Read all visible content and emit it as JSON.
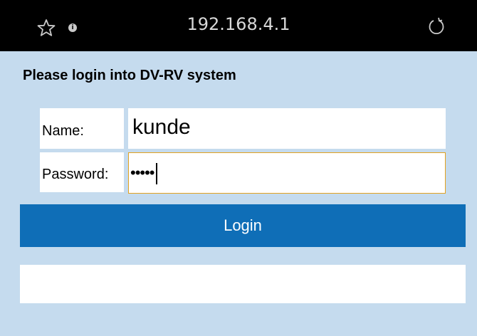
{
  "browser": {
    "url": "192.168.4.1",
    "icons": [
      "star-icon",
      "info-icon",
      "reload-icon"
    ],
    "info_glyph": "i"
  },
  "login": {
    "heading": "Please login into DV-RV system",
    "name_label": "Name:",
    "name_value": "kunde",
    "password_label": "Password:",
    "password_masked": "•••••",
    "button_label": "Login",
    "message": ""
  },
  "colors": {
    "page_background": "#c5dbee",
    "topbar": "#000000",
    "button": "#0f6eb7",
    "focus_border": "#e3a21f"
  }
}
